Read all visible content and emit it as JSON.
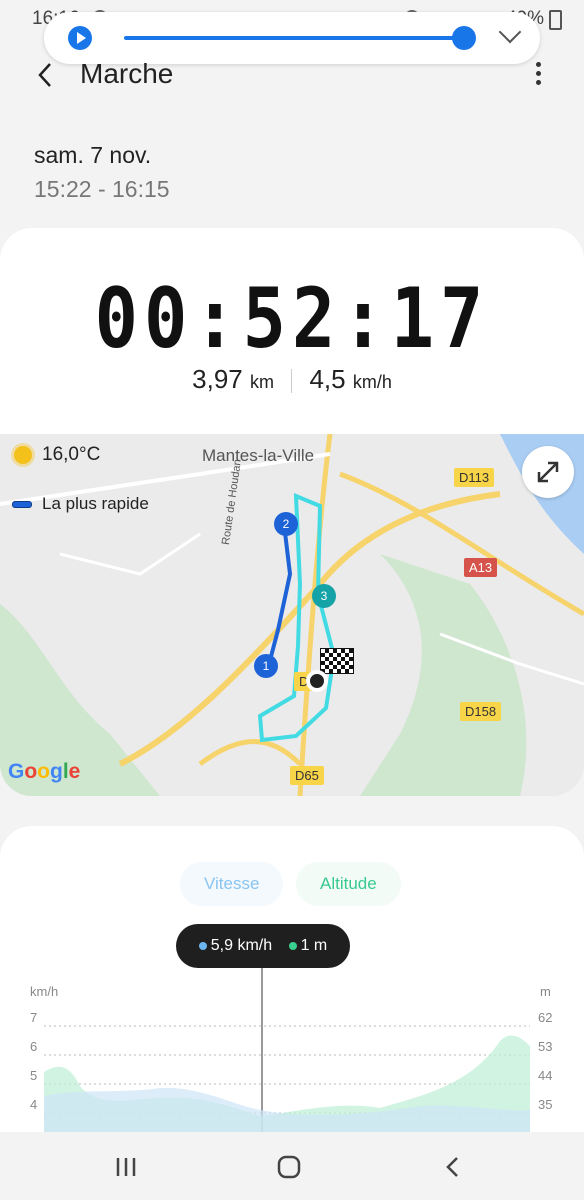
{
  "status_bar": {
    "time": "16:16",
    "battery": "49%"
  },
  "media": {
    "play_icon": "play-icon",
    "collapse_icon": "chevron-down-icon"
  },
  "header": {
    "title": "Marche"
  },
  "session": {
    "date": "sam. 7 nov.",
    "time_range": "15:22 - 16:15"
  },
  "summary": {
    "duration": "00:52:17",
    "distance": "3,97",
    "distance_unit": "km",
    "speed": "4,5",
    "speed_unit": "km/h"
  },
  "map": {
    "weather": "16,0°C",
    "legend": "La plus rapide",
    "place_label": "Mantes-la-Ville",
    "road_label": "Route de Houdan",
    "road_shields": [
      "D113",
      "A13",
      "D158",
      "D65",
      "D9"
    ],
    "markers": [
      "1",
      "2",
      "3"
    ],
    "brand": "Google"
  },
  "graph": {
    "tabs": [
      "Vitesse",
      "Altitude"
    ],
    "tooltip_speed": "5,9 km/h",
    "tooltip_alt": "1 m",
    "left_unit": "km/h",
    "right_unit": "m",
    "left_ticks": [
      "7",
      "6",
      "5",
      "4"
    ],
    "right_ticks": [
      "62",
      "53",
      "44",
      "35"
    ]
  },
  "nav": {
    "recent": "recent-apps-icon",
    "home": "home-icon",
    "back": "back-icon"
  }
}
